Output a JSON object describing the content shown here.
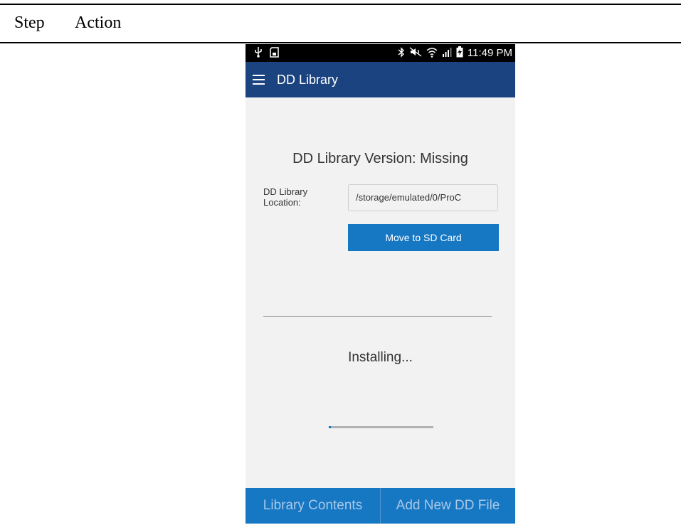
{
  "document": {
    "col_step": "Step",
    "col_action": "Action"
  },
  "status_bar": {
    "left_icons": [
      "usb-icon",
      "sd-card-icon"
    ],
    "right_icons": [
      "bluetooth-icon",
      "mute-icon",
      "wifi-icon",
      "signal-icon",
      "battery-charging-icon"
    ],
    "time": "11:49 PM"
  },
  "app_bar": {
    "title": "DD Library"
  },
  "main": {
    "version_text": "DD Library Version: Missing",
    "location_label": "DD Library Location:",
    "location_value": "/storage/emulated/0/ProC",
    "move_button": "Move to SD Card",
    "installing_text": "Installing...",
    "progress": 0.02
  },
  "bottom_bar": {
    "tabs": [
      "Library Contents",
      "Add New DD File"
    ]
  },
  "colors": {
    "app_bar": "#1a4380",
    "accent": "#1677c3",
    "background": "#f2f2f2"
  }
}
